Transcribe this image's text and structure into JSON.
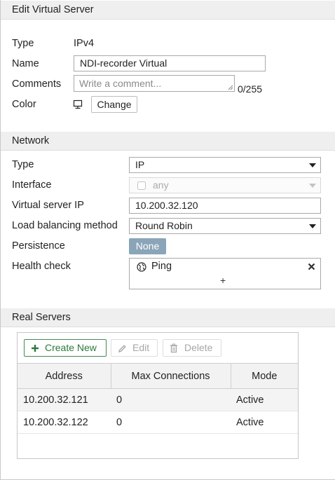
{
  "header": {
    "title": "Edit Virtual Server"
  },
  "general": {
    "type_label": "Type",
    "type_value": "IPv4",
    "name_label": "Name",
    "name_value": "NDI-recorder Virtual",
    "comments_label": "Comments",
    "comments_placeholder": "Write a comment...",
    "comments_counter": "0/255",
    "color_label": "Color",
    "color_button": "Change"
  },
  "network": {
    "section_title": "Network",
    "type_label": "Type",
    "type_value": "IP",
    "interface_label": "Interface",
    "interface_value": "any",
    "vip_label": "Virtual server IP",
    "vip_value": "10.200.32.120",
    "lb_label": "Load balancing method",
    "lb_value": "Round Robin",
    "persistence_label": "Persistence",
    "persistence_value": "None",
    "health_label": "Health check",
    "health_item": "Ping",
    "health_add": "+"
  },
  "real_servers": {
    "section_title": "Real Servers",
    "toolbar": {
      "create_label": "Create New",
      "edit_label": "Edit",
      "delete_label": "Delete"
    },
    "columns": [
      "Address",
      "Max Connections",
      "Mode"
    ],
    "rows": [
      {
        "address": "10.200.32.121",
        "max": "0",
        "mode": "Active"
      },
      {
        "address": "10.200.32.122",
        "max": "0",
        "mode": "Active"
      }
    ]
  },
  "icons": {
    "monitor": "monitor-icon",
    "globe": "globe-icon",
    "close": "close-icon",
    "plus": "plus-icon",
    "pencil": "pencil-icon",
    "trash": "trash-icon",
    "checkbox": "checkbox-icon"
  },
  "colors": {
    "accent_green": "#2c7a3b",
    "pill": "#8aa5b8",
    "header_bg": "#efefef"
  }
}
